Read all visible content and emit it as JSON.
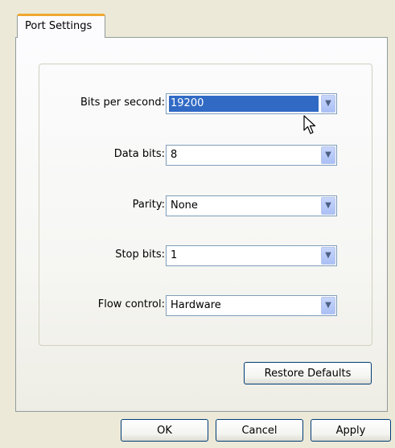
{
  "tab": {
    "label": "Port Settings"
  },
  "fields": [
    {
      "label": "Bits per second:",
      "value": "19200"
    },
    {
      "label": "Data bits:",
      "value": "8"
    },
    {
      "label": "Parity:",
      "value": "None"
    },
    {
      "label": "Stop bits:",
      "value": "1"
    },
    {
      "label": "Flow control:",
      "value": "Hardware"
    }
  ],
  "buttons": {
    "restore_defaults": "Restore Defaults",
    "ok": "OK",
    "cancel": "Cancel",
    "apply": "Apply"
  },
  "icons": {
    "dropdown": "chevron-down-icon",
    "cursor": "mouse-pointer-icon"
  },
  "colors": {
    "selection": "#316ac5",
    "tab_accent": "#f0a830",
    "dialog_background": "#ece9d8"
  }
}
